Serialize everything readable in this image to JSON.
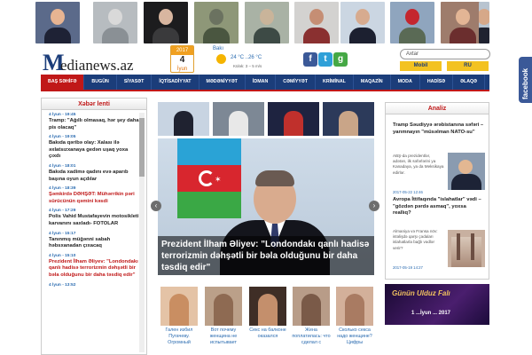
{
  "top_photos": [
    {
      "label": "Trump photo",
      "bg": "#5b6a8a",
      "skin": "#e7b492",
      "cloth": "#1e2235"
    },
    {
      "label": "Corridor photo",
      "bg": "#b7bcc0",
      "skin": "#d9d9d9",
      "cloth": "#8a9095"
    },
    {
      "label": "Woman photo",
      "bg": "#1c1c1e",
      "skin": "#d8b6a0",
      "cloth": "#3a3a3c"
    },
    {
      "label": "Car crash photo",
      "bg": "#8e9778",
      "skin": "#6b7260",
      "cloth": "#4a5640"
    },
    {
      "label": "Police photo",
      "bg": "#a9b2a5",
      "skin": "#c9b49a",
      "cloth": "#3d4a45"
    },
    {
      "label": "Woman legs photo",
      "bg": "#d3d2d0",
      "skin": "#c58e74",
      "cloth": "#8a3030"
    },
    {
      "label": "Aliyev photo",
      "bg": "#cbd6e2",
      "skin": "#d7ab8f",
      "cloth": "#1c2030"
    },
    {
      "label": "Stop sign photo",
      "bg": "#8fa5be",
      "skin": "#c4262e",
      "cloth": "#5a6a55"
    },
    {
      "label": "Woman portrait photo",
      "bg": "#9e7c6c",
      "skin": "#e3b595",
      "cloth": "#6b2e2e"
    },
    {
      "label": "Man flag photo",
      "bg": "#b8c4d0",
      "skin": "#d6a889",
      "cloth": "#1f2230"
    }
  ],
  "logo": {
    "first": "M",
    "rest": "edianews.az"
  },
  "date": {
    "year": "2017",
    "day": "4",
    "month": "İyun"
  },
  "weather": {
    "city": "Bakı",
    "temp": "24 °C ..26 °C",
    "wind": "Külək: 3 – 5 m/s"
  },
  "social": [
    {
      "name": "facebook-icon",
      "letter": "f",
      "color": "#3b5998"
    },
    {
      "name": "twitter-icon",
      "letter": "t",
      "color": "#2fa0d8"
    },
    {
      "name": "google-plus-icon",
      "letter": "g",
      "color": "#45a845"
    }
  ],
  "search": {
    "placeholder": "Axtar"
  },
  "lang": {
    "mobil": "Mobil",
    "ru": "RU"
  },
  "nav": [
    "BAŞ SƏHİFƏ",
    "BUGÜN",
    "SİYASƏT",
    "İQTİSADİYYAT",
    "MƏDƏNİYYƏT",
    "İDMAN",
    "CƏMİYYƏT",
    "KRİMİNAL",
    "MAQAZİN",
    "MODA",
    "HADİSƏ",
    "ƏLAQƏ"
  ],
  "news_title": "Xəbər lenti",
  "news": [
    {
      "time": "4 İyun - 19:45",
      "text": "Tramp: \"Ağıllı olmasaq, hər şey daha pis olacaq\"",
      "red": false
    },
    {
      "time": "4 İyun - 19:05",
      "text": "Bakıda qəribə olay: Xalası ilə əxlatsızxanaya gedən uşaq yoxa çıxdı",
      "red": false
    },
    {
      "time": "4 İyun - 18:01",
      "text": "Bakıda xadimə qadını evə aparıb başına oyun açdılar",
      "red": false
    },
    {
      "time": "4 İyun - 18:39",
      "text": "Şəmkirdə DƏHŞƏT: Mühərrikin pəri sürücünün qəmini kəsdi",
      "red": true
    },
    {
      "time": "4 İyun - 17:29",
      "text": "Polis Vahid Mustafayevin motosikleti karvanını saxladı- FOTOLAR",
      "red": false
    },
    {
      "time": "4 İyun - 15:17",
      "text": "Tanınmış müğənni sabah həbsxanadan çıxacaq",
      "red": false
    },
    {
      "time": "4 İyun - 15:10",
      "text": "Prezident İlham Əliyev: \"Londondakı qanlı hadisə terrorizmin dəhşətli bir bəla olduğunu bir daha təsdiq edir\"",
      "red": true
    },
    {
      "time": "4 İyun - 13:52",
      "text": "",
      "red": false
    }
  ],
  "slider_thumbs": [
    {
      "label": "Aliyev flag thumb",
      "bg": "#c8d4e2",
      "fg": "#1f2230"
    },
    {
      "label": "Meeting thumb",
      "bg": "#7d8895",
      "fg": "#e8e8e8"
    },
    {
      "label": "Night city thumb",
      "bg": "#1e2340",
      "fg": "#c0302c"
    },
    {
      "label": "Conference thumb",
      "bg": "#2c3a5a",
      "fg": "#c9a588"
    }
  ],
  "slider_caption": "Prezident İlham Əliyev: \"Londondakı qanlı hadisə terrorizmin dəhşətli bir bəla olduğunu bir daha təsdiq edir\"",
  "bottom_thumbs": [
    {
      "caption": "Гален избил Пугачеву. Огромный",
      "bg": "#e4c3a6",
      "fg": "#c98e62"
    },
    {
      "caption": "Вот почему женщина не испытывает",
      "bg": "#bba089",
      "fg": "#8e6a52"
    },
    {
      "caption": "Секс на балконе оказался",
      "bg": "#3f2e26",
      "fg": "#c48f6c"
    },
    {
      "caption": "Жена поплатилась: что сделал с",
      "bg": "#b89c88",
      "fg": "#7a5a48"
    },
    {
      "caption": "Сколько секса надо женщине? Цифры",
      "bg": "#d3b09a",
      "fg": "#a97b62"
    }
  ],
  "analiz_title": "Analiz",
  "analiz": [
    {
      "title": "Tramp Səudiyyə ərəbistanına səfəri – yarımnayın \"müsəlman NATO-su\"",
      "text": "ABŞ-da prezidentlər, adətən, ilk səfərlərini ya Kanadaya, ya da Meksikaya edirlər.",
      "date": "2017-05-22 12:46"
    },
    {
      "title": "Avropa İttifaqında \"islahatlar\" vədi – \"gözdən pərdə asmaq\", yoxsa reallıq?",
      "text": "Almaniya və Fransa növ: istəlişdə qarşı çədaları islahatlarla bağlı vədlər verir?",
      "date": "2017-05-19 14:27"
    }
  ],
  "horoscope": {
    "title": "Günün Ulduz Falı",
    "sub": "1 ...İyun ... 2017"
  },
  "facebook_tab": "facebook"
}
